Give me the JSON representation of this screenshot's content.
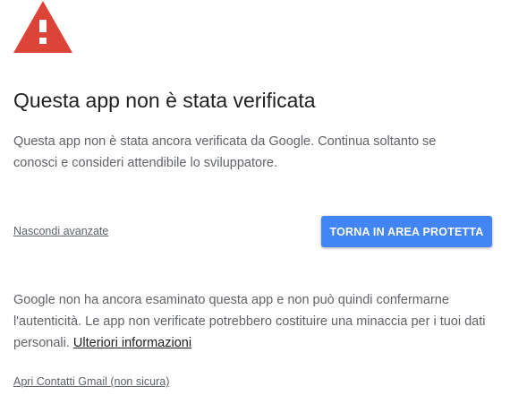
{
  "interstitial": {
    "icon": "warning-triangle-icon",
    "icon_color": "#db4437",
    "title": "Questa app non è stata verificata",
    "description": "Questa app non è stata ancora verificata da Google. Continua soltanto se conosci e consideri attendibile lo sviluppatore.",
    "hide_advanced_label": "Nascondi avanzate",
    "back_button_label": "TORNA IN AREA PROTETTA",
    "back_button_color": "#4285f4",
    "advanced_text": "Google non ha ancora esaminato questa app e non può quindi confermarne l'autenticità. Le app non verificate potrebbero costituire una minaccia per i tuoi dati personali.",
    "learn_more_label": "Ulteriori informazioni",
    "proceed_label": "Apri Contatti Gmail (non sicura)"
  }
}
